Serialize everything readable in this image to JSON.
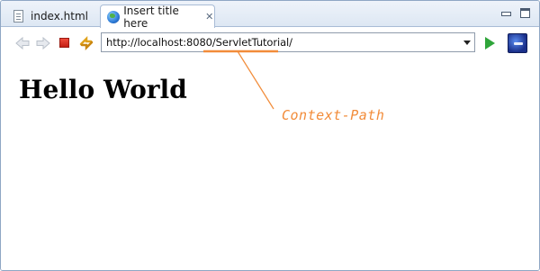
{
  "tabs": [
    {
      "label": "index.html",
      "icon": "html-file-icon",
      "active": false
    },
    {
      "label": "Insert title here",
      "icon": "globe-icon",
      "active": true
    }
  ],
  "toolbar": {
    "url": "http://localhost:8080/ServletTutorial/",
    "back_icon": "back-arrow-icon",
    "forward_icon": "forward-arrow-icon",
    "stop_icon": "stop-icon",
    "refresh_icon": "refresh-icon",
    "go_icon": "go-icon",
    "eclipse_icon": "eclipse-icon"
  },
  "page": {
    "heading": "Hello World"
  },
  "annotation": {
    "label": "Context-Path",
    "color": "#f28c3a"
  }
}
